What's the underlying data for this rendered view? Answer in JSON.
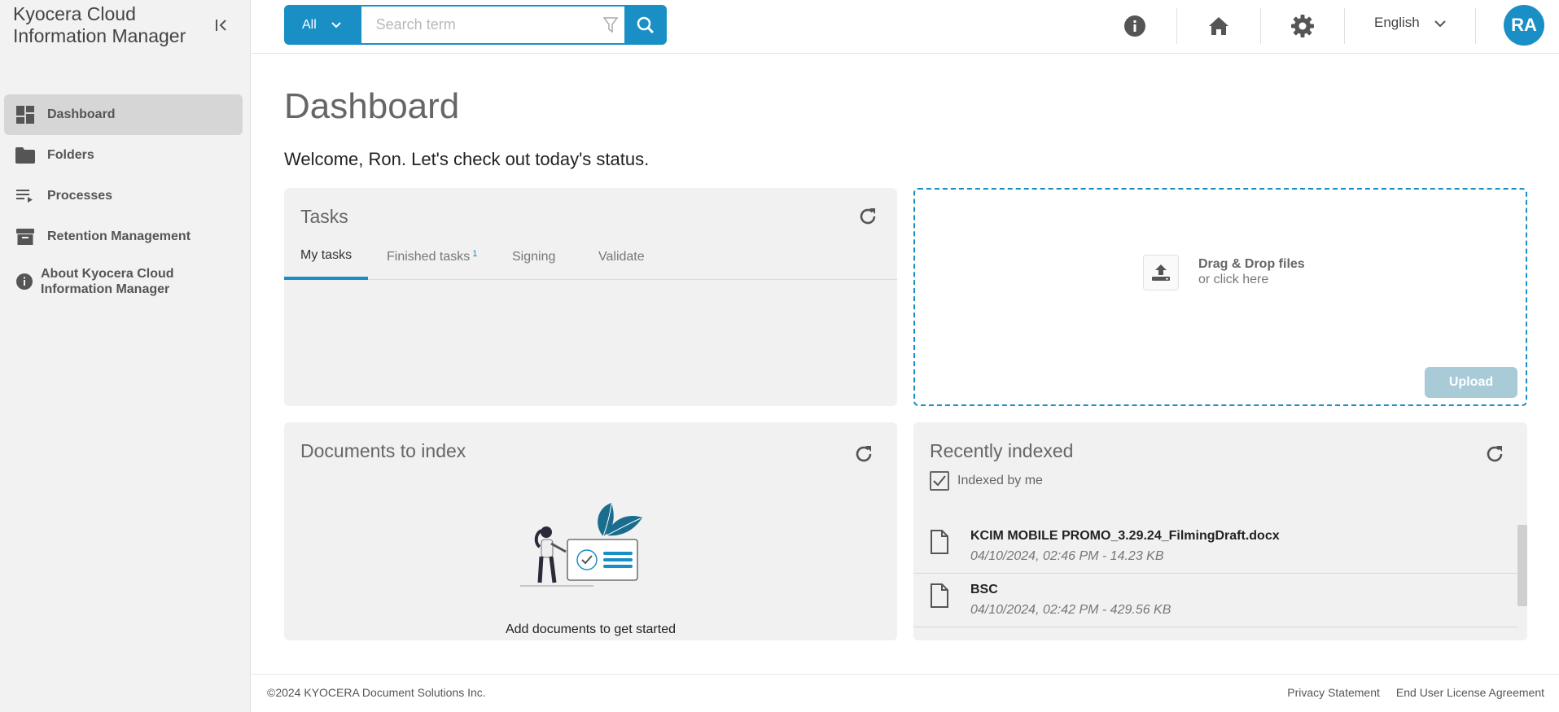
{
  "app": {
    "title": "Kyocera Cloud Information Manager"
  },
  "sidebar": {
    "items": [
      {
        "label": "Dashboard",
        "icon": "dashboard-icon"
      },
      {
        "label": "Folders",
        "icon": "folder-icon"
      },
      {
        "label": "Processes",
        "icon": "processes-icon"
      },
      {
        "label": "Retention Management",
        "icon": "archive-icon"
      },
      {
        "label": "About Kyocera Cloud Information Manager",
        "icon": "info-icon"
      }
    ]
  },
  "topbar": {
    "search_scope": "All",
    "search_placeholder": "Search term",
    "language": "English",
    "avatar_initials": "RA"
  },
  "colors": {
    "accent": "#1a8fc5",
    "upload_disabled": "#a9cbd7"
  },
  "main": {
    "title": "Dashboard",
    "welcome": "Welcome, Ron. Let's check out today's status.",
    "tasks": {
      "title": "Tasks",
      "tabs": [
        {
          "label": "My tasks",
          "badge": ""
        },
        {
          "label": "Finished tasks",
          "badge": "1"
        },
        {
          "label": "Signing",
          "badge": ""
        },
        {
          "label": "Validate",
          "badge": ""
        }
      ]
    },
    "upload": {
      "line1": "Drag & Drop files",
      "line2": "or click here",
      "button": "Upload"
    },
    "documents_to_index": {
      "title": "Documents to index",
      "empty_caption": "Add documents to get started"
    },
    "recently_indexed": {
      "title": "Recently indexed",
      "checkbox_label": "Indexed by me",
      "items": [
        {
          "name": "KCIM MOBILE PROMO_3.29.24_FilmingDraft.docx",
          "meta": "04/10/2024, 02:46 PM - 14.23 KB"
        },
        {
          "name": "BSC",
          "meta": "04/10/2024, 02:42 PM - 429.56 KB"
        }
      ]
    }
  },
  "footer": {
    "copyright": "©2024 KYOCERA Document Solutions Inc.",
    "privacy": "Privacy Statement",
    "eula": "End User License Agreement"
  }
}
